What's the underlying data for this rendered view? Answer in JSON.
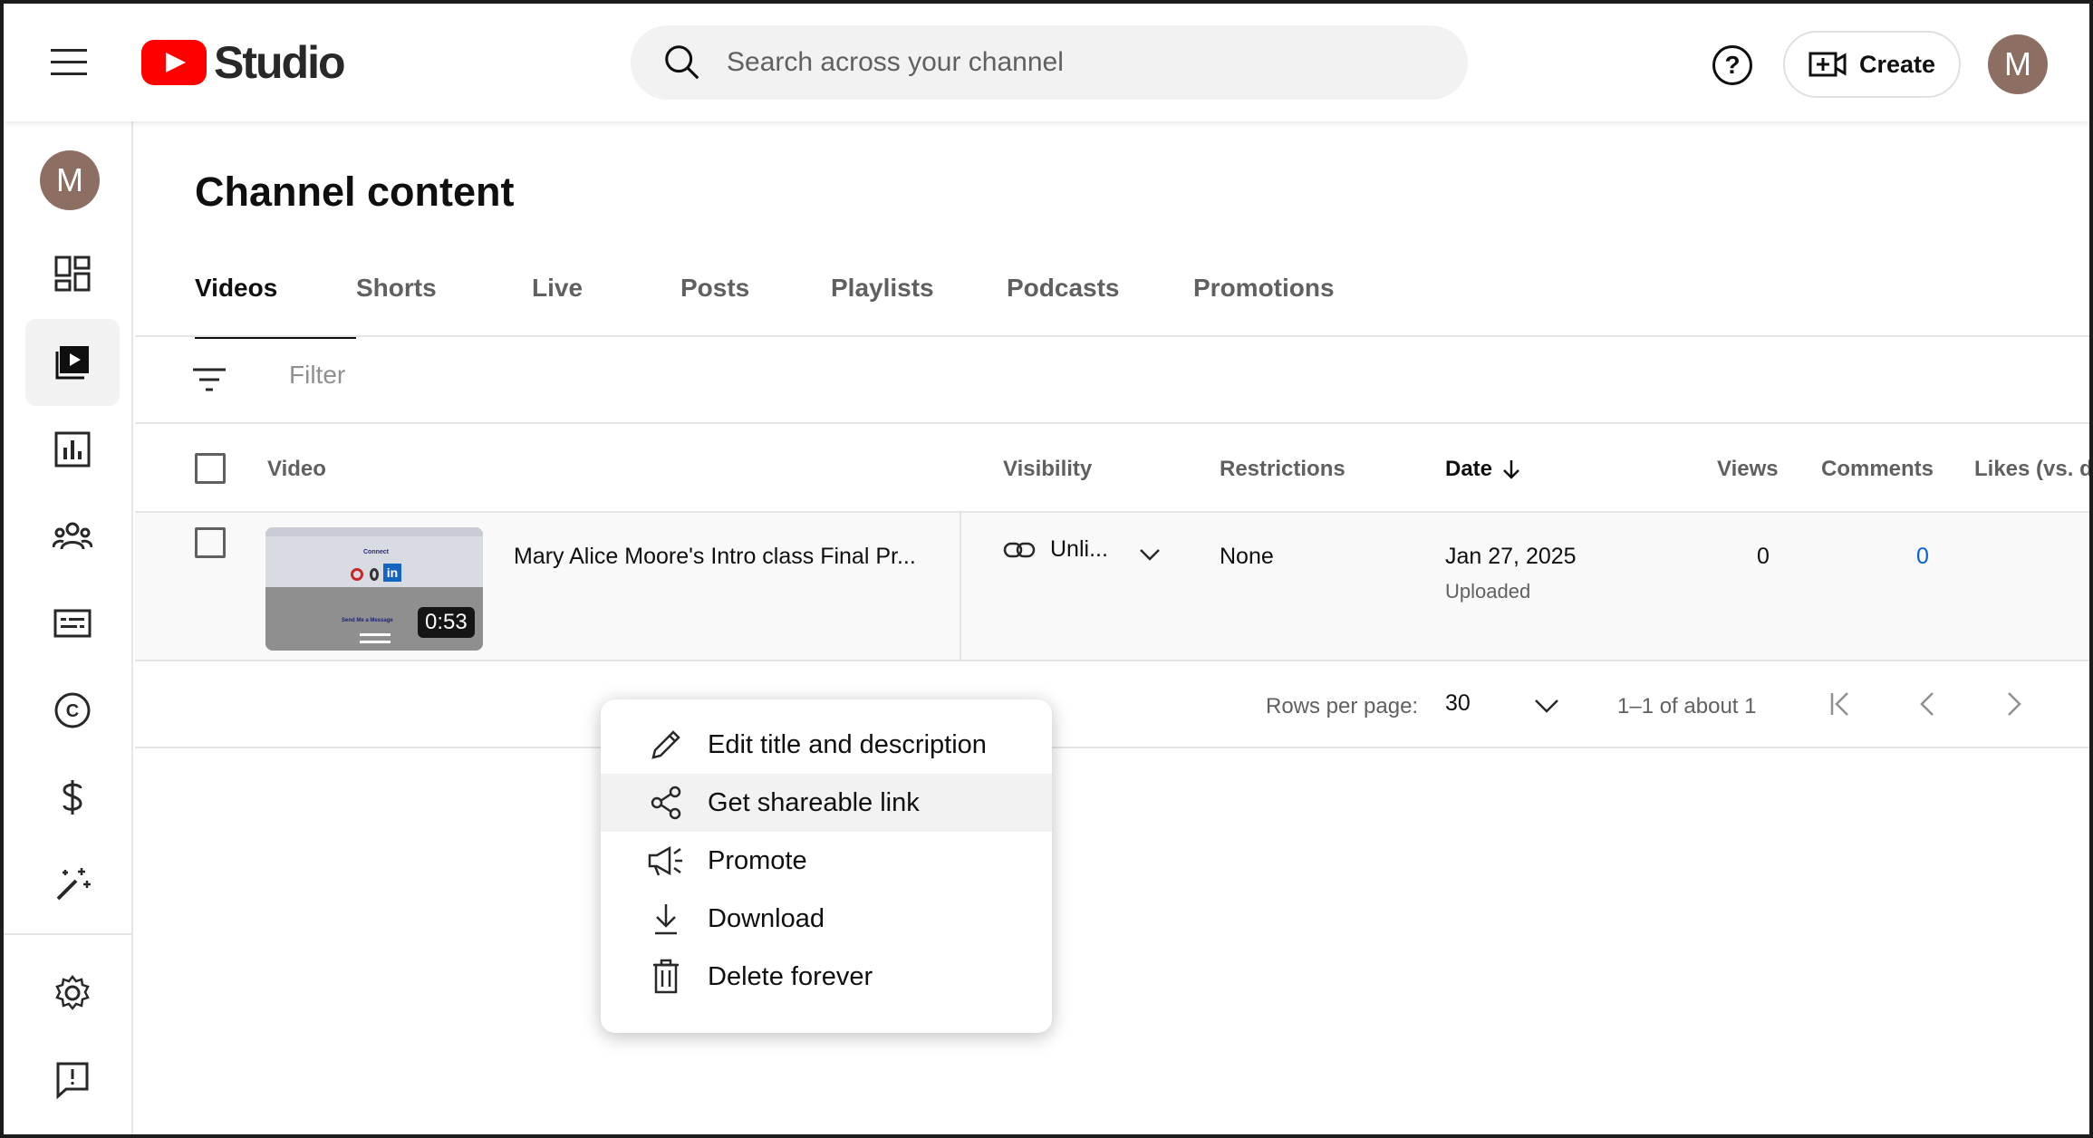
{
  "header": {
    "logo_text": "Studio",
    "search_placeholder": "Search across your channel",
    "help_label": "?",
    "create_label": "Create",
    "avatar_initial": "M"
  },
  "sidebar": {
    "avatar_initial": "M",
    "items": [
      "dashboard",
      "content",
      "analytics",
      "community",
      "subtitles",
      "copyright",
      "earn",
      "customization",
      "settings",
      "send-feedback"
    ]
  },
  "page": {
    "title": "Channel content",
    "tabs": [
      "Videos",
      "Shorts",
      "Live",
      "Posts",
      "Playlists",
      "Podcasts",
      "Promotions"
    ],
    "active_tab": "Videos",
    "filter_placeholder": "Filter"
  },
  "table": {
    "headers": {
      "video": "Video",
      "visibility": "Visibility",
      "restrictions": "Restrictions",
      "date": "Date",
      "views": "Views",
      "comments": "Comments",
      "likes": "Likes (vs. di"
    },
    "rows": [
      {
        "title": "Mary Alice Moore's Intro class Final Pr...",
        "duration": "0:53",
        "thumb_connect": "Connect",
        "thumb_li": "in",
        "thumb_msg": "Send Me a Message",
        "visibility": "Unli...",
        "restrictions": "None",
        "date": "Jan 27, 2025",
        "date_status": "Uploaded",
        "views": "0",
        "comments": "0"
      }
    ]
  },
  "pagination": {
    "rows_label": "Rows per page:",
    "rows_value": "30",
    "range": "1–1 of about 1"
  },
  "context_menu": {
    "items": [
      {
        "label": "Edit title and description",
        "icon": "pencil-icon"
      },
      {
        "label": "Get shareable link",
        "icon": "share-icon"
      },
      {
        "label": "Promote",
        "icon": "megaphone-icon"
      },
      {
        "label": "Download",
        "icon": "download-icon"
      },
      {
        "label": "Delete forever",
        "icon": "trash-icon"
      }
    ],
    "hovered_index": 1
  }
}
